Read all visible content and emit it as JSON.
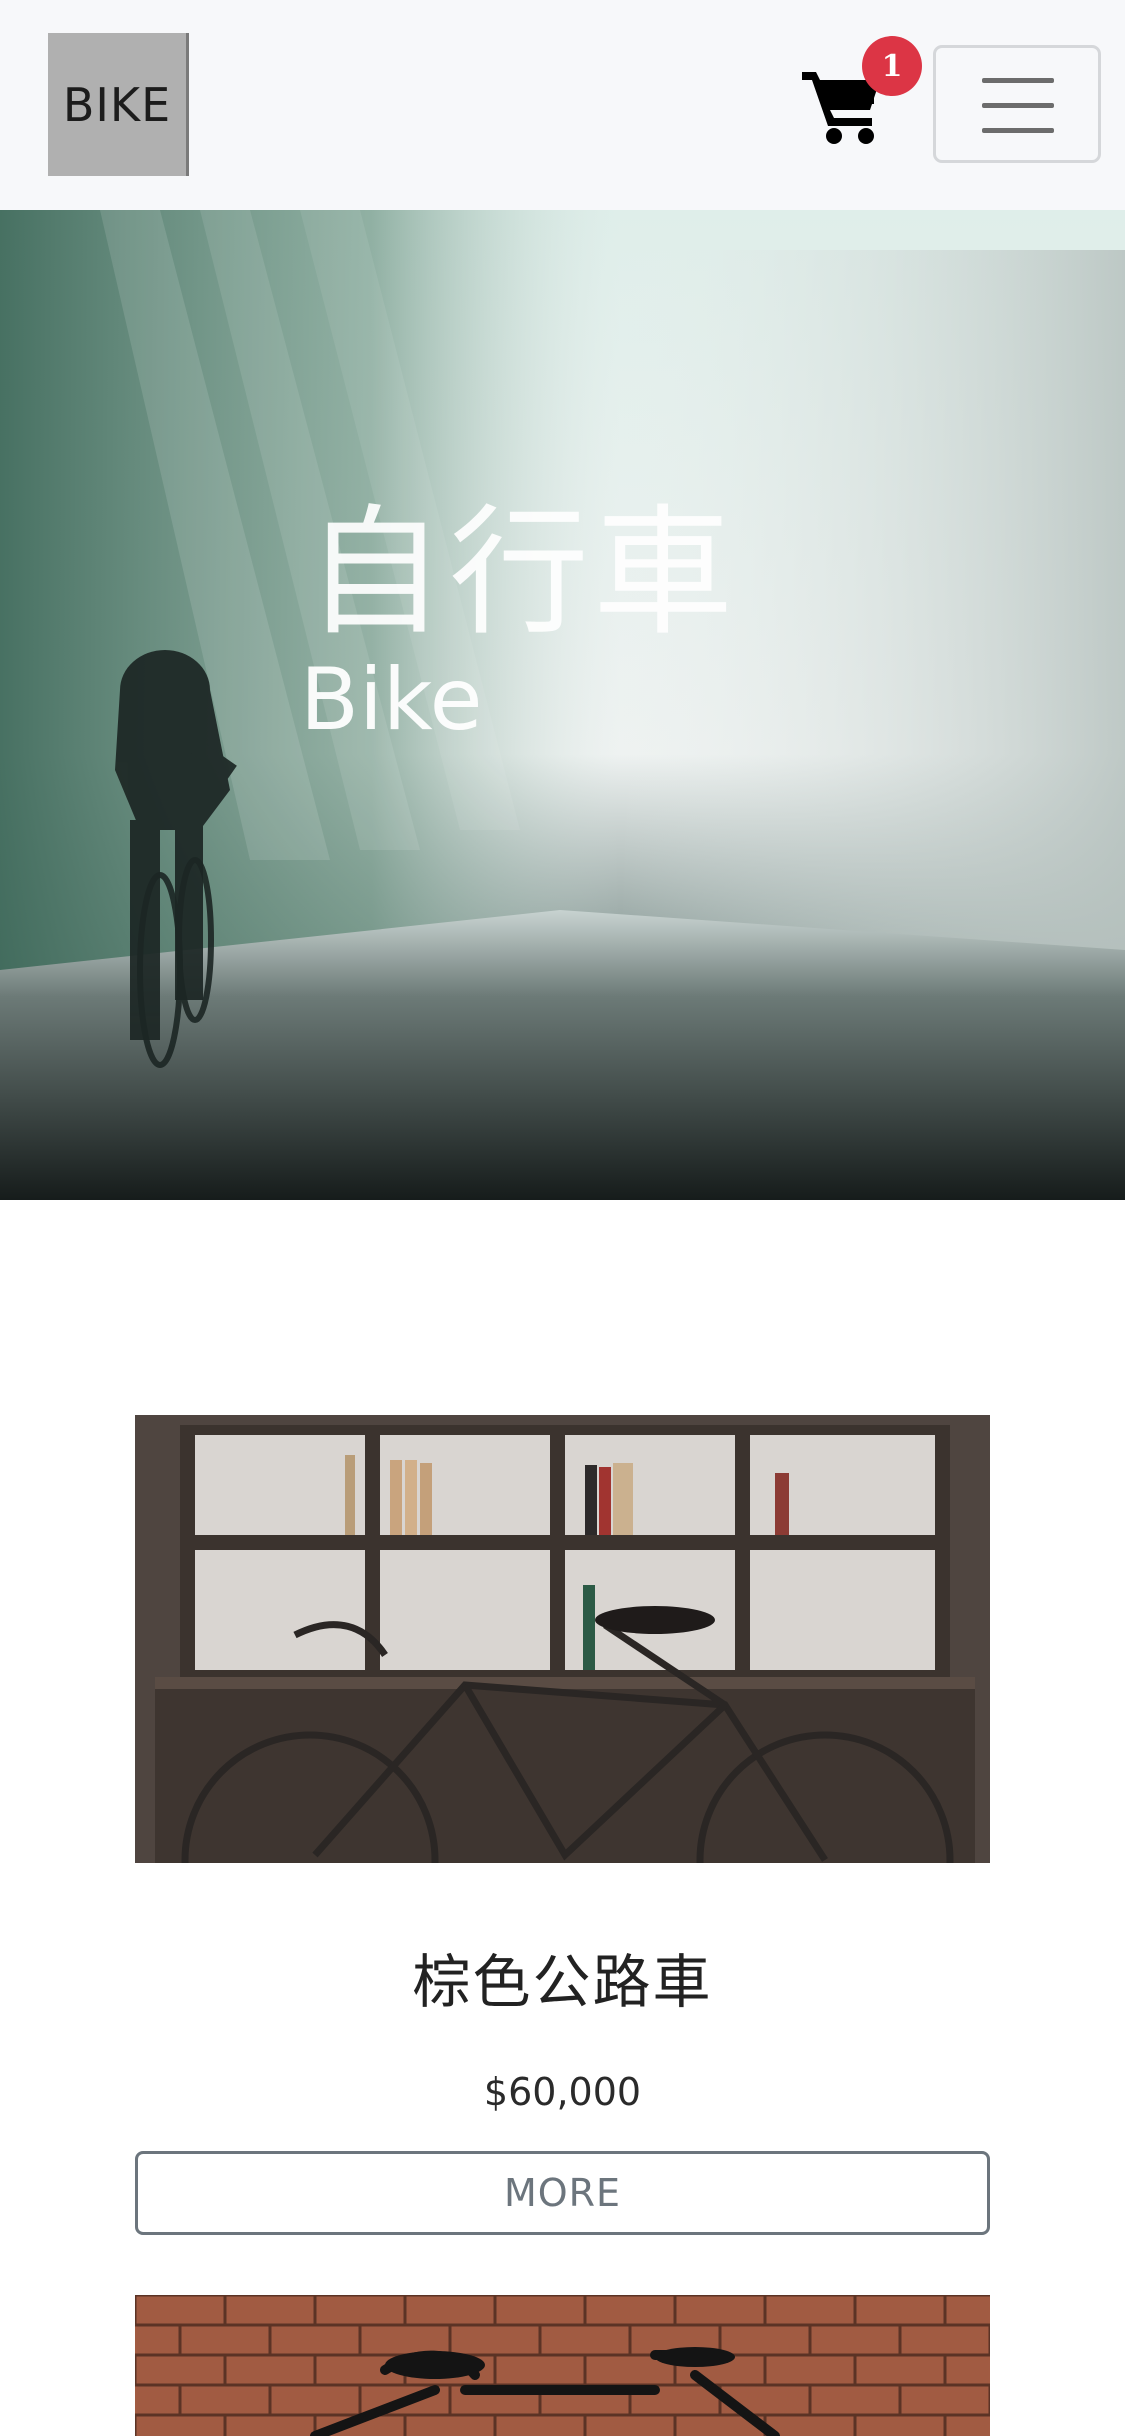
{
  "navbar": {
    "logo_text": "BIKE",
    "cart_icon": "shopping-cart-icon",
    "cart_count": "1",
    "menu_icon": "hamburger-menu-icon",
    "colors": {
      "background": "#f7f8fa",
      "badge": "#dc3545"
    }
  },
  "hero": {
    "title": "自行車",
    "subtitle": "Bike"
  },
  "products": [
    {
      "name": "棕色公路車",
      "price": "$60,000",
      "more_label": "MORE"
    }
  ]
}
